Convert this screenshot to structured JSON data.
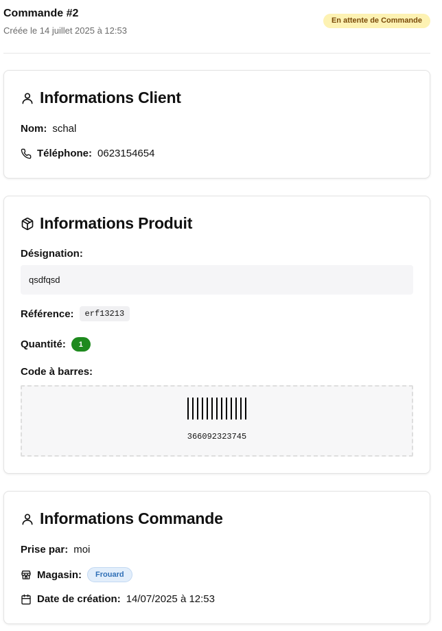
{
  "header": {
    "title": "Commande #2",
    "subtitle": "Créée le 14 juillet 2025 à 12:53",
    "status": "En attente de Commande"
  },
  "client": {
    "title": "Informations Client",
    "icon": "user-icon",
    "name_label": "Nom:",
    "name_value": "schal",
    "phone_label": "Téléphone:",
    "phone_value": "0623154654"
  },
  "product": {
    "title": "Informations Produit",
    "icon": "package-icon",
    "designation_label": "Désignation:",
    "designation_value": "qsdfqsd",
    "reference_label": "Référence:",
    "reference_value": "erf13213",
    "quantity_label": "Quantité:",
    "quantity_value": "1",
    "barcode_label": "Code à barres:",
    "barcode_value": "366092323745"
  },
  "order": {
    "title": "Informations Commande",
    "icon": "user-icon",
    "taken_by_label": "Prise par:",
    "taken_by_value": "moi",
    "store_label": "Magasin:",
    "store_value": "Frouard",
    "created_label": "Date de création:",
    "created_value": "14/07/2025 à 12:53"
  },
  "colors": {
    "status_bg": "#fdf2b3",
    "status_text": "#7a4b0a",
    "quantity_badge": "#1e8a1e",
    "store_badge_bg": "#e2eefb",
    "store_badge_text": "#2f6fb6"
  }
}
